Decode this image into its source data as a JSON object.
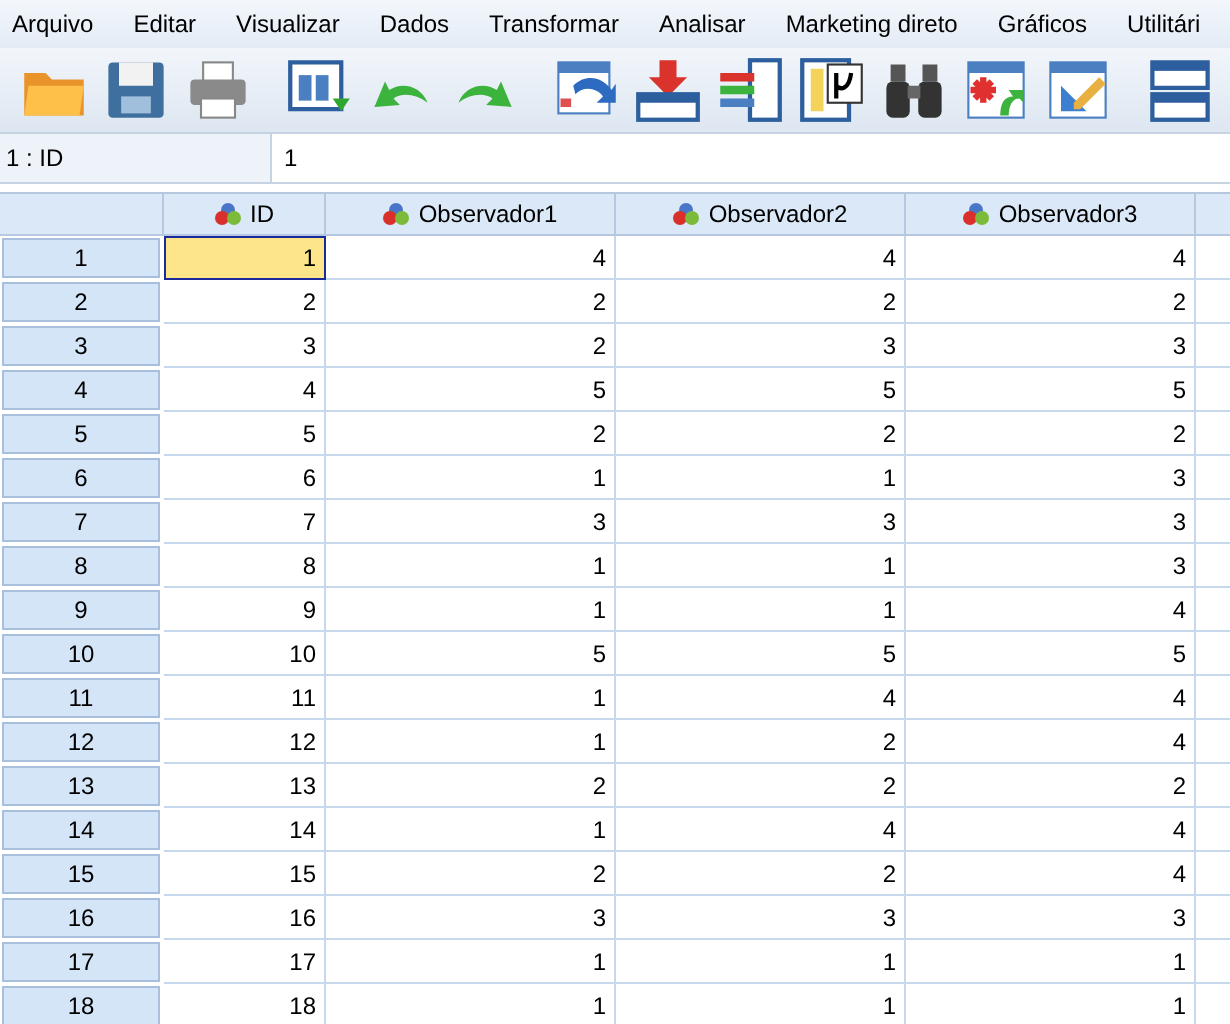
{
  "menu": [
    "Arquivo",
    "Editar",
    "Visualizar",
    "Dados",
    "Transformar",
    "Analisar",
    "Marketing direto",
    "Gráficos",
    "Utilitári"
  ],
  "cell_editor": {
    "reference": "1 : ID",
    "value": "1"
  },
  "columns": [
    "ID",
    "Observador1",
    "Observador2",
    "Observador3"
  ],
  "rows": [
    {
      "label": "1",
      "cells": [
        {
          "value": "1",
          "selected": true
        },
        {
          "value": "4",
          "selected": false
        },
        {
          "value": "4",
          "selected": false
        },
        {
          "value": "4",
          "selected": false
        }
      ]
    },
    {
      "label": "2",
      "cells": [
        {
          "value": "2",
          "selected": false
        },
        {
          "value": "2",
          "selected": false
        },
        {
          "value": "2",
          "selected": false
        },
        {
          "value": "2",
          "selected": false
        }
      ]
    },
    {
      "label": "3",
      "cells": [
        {
          "value": "3",
          "selected": false
        },
        {
          "value": "2",
          "selected": false
        },
        {
          "value": "3",
          "selected": false
        },
        {
          "value": "3",
          "selected": false
        }
      ]
    },
    {
      "label": "4",
      "cells": [
        {
          "value": "4",
          "selected": false
        },
        {
          "value": "5",
          "selected": false
        },
        {
          "value": "5",
          "selected": false
        },
        {
          "value": "5",
          "selected": false
        }
      ]
    },
    {
      "label": "5",
      "cells": [
        {
          "value": "5",
          "selected": false
        },
        {
          "value": "2",
          "selected": false
        },
        {
          "value": "2",
          "selected": false
        },
        {
          "value": "2",
          "selected": false
        }
      ]
    },
    {
      "label": "6",
      "cells": [
        {
          "value": "6",
          "selected": false
        },
        {
          "value": "1",
          "selected": false
        },
        {
          "value": "1",
          "selected": false
        },
        {
          "value": "3",
          "selected": false
        }
      ]
    },
    {
      "label": "7",
      "cells": [
        {
          "value": "7",
          "selected": false
        },
        {
          "value": "3",
          "selected": false
        },
        {
          "value": "3",
          "selected": false
        },
        {
          "value": "3",
          "selected": false
        }
      ]
    },
    {
      "label": "8",
      "cells": [
        {
          "value": "8",
          "selected": false
        },
        {
          "value": "1",
          "selected": false
        },
        {
          "value": "1",
          "selected": false
        },
        {
          "value": "3",
          "selected": false
        }
      ]
    },
    {
      "label": "9",
      "cells": [
        {
          "value": "9",
          "selected": false
        },
        {
          "value": "1",
          "selected": false
        },
        {
          "value": "1",
          "selected": false
        },
        {
          "value": "4",
          "selected": false
        }
      ]
    },
    {
      "label": "10",
      "cells": [
        {
          "value": "10",
          "selected": false
        },
        {
          "value": "5",
          "selected": false
        },
        {
          "value": "5",
          "selected": false
        },
        {
          "value": "5",
          "selected": false
        }
      ]
    },
    {
      "label": "11",
      "cells": [
        {
          "value": "11",
          "selected": false
        },
        {
          "value": "1",
          "selected": false
        },
        {
          "value": "4",
          "selected": false
        },
        {
          "value": "4",
          "selected": false
        }
      ]
    },
    {
      "label": "12",
      "cells": [
        {
          "value": "12",
          "selected": false
        },
        {
          "value": "1",
          "selected": false
        },
        {
          "value": "2",
          "selected": false
        },
        {
          "value": "4",
          "selected": false
        }
      ]
    },
    {
      "label": "13",
      "cells": [
        {
          "value": "13",
          "selected": false
        },
        {
          "value": "2",
          "selected": false
        },
        {
          "value": "2",
          "selected": false
        },
        {
          "value": "2",
          "selected": false
        }
      ]
    },
    {
      "label": "14",
      "cells": [
        {
          "value": "14",
          "selected": false
        },
        {
          "value": "1",
          "selected": false
        },
        {
          "value": "4",
          "selected": false
        },
        {
          "value": "4",
          "selected": false
        }
      ]
    },
    {
      "label": "15",
      "cells": [
        {
          "value": "15",
          "selected": false
        },
        {
          "value": "2",
          "selected": false
        },
        {
          "value": "2",
          "selected": false
        },
        {
          "value": "4",
          "selected": false
        }
      ]
    },
    {
      "label": "16",
      "cells": [
        {
          "value": "16",
          "selected": false
        },
        {
          "value": "3",
          "selected": false
        },
        {
          "value": "3",
          "selected": false
        },
        {
          "value": "3",
          "selected": false
        }
      ]
    },
    {
      "label": "17",
      "cells": [
        {
          "value": "17",
          "selected": false
        },
        {
          "value": "1",
          "selected": false
        },
        {
          "value": "1",
          "selected": false
        },
        {
          "value": "1",
          "selected": false
        }
      ]
    },
    {
      "label": "18",
      "cells": [
        {
          "value": "18",
          "selected": false
        },
        {
          "value": "1",
          "selected": false
        },
        {
          "value": "1",
          "selected": false
        },
        {
          "value": "1",
          "selected": false
        }
      ]
    }
  ]
}
